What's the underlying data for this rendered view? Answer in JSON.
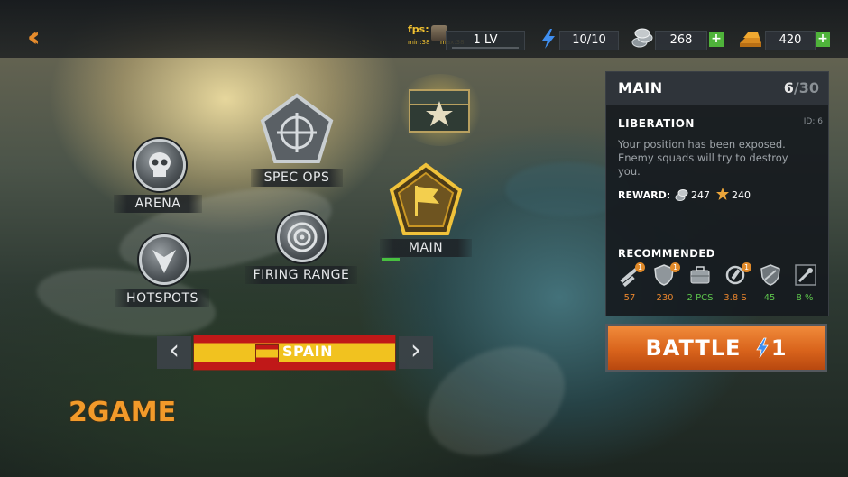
{
  "topbar": {
    "back_icon": "double-chevron-left-icon",
    "fps": "fps: 42",
    "fps_min": "min:38",
    "fps_max": "max:38",
    "level": "1 LV",
    "energy": "10/10",
    "silver": "268",
    "gold": "420"
  },
  "map": {
    "nodes": [
      {
        "label": "SPEC OPS",
        "icon": "crosshair-pentagon-icon"
      },
      {
        "label": "ARENA",
        "icon": "skull-icon"
      },
      {
        "label": "MAIN",
        "icon": "flag-icon"
      },
      {
        "label": "FIRING RANGE",
        "icon": "target-icon"
      },
      {
        "label": "HOTSPOTS",
        "icon": "chevron-down-icon"
      }
    ]
  },
  "panel": {
    "title": "MAIN",
    "progress_current": "6",
    "progress_total": "/30",
    "mission_name": "LIBERATION",
    "mission_id": "ID: 6",
    "description": "Your position has been exposed. Enemy squads will try to destroy you.",
    "reward_label": "REWARD:",
    "reward_silver": "247",
    "reward_star": "240",
    "recommended_label": "RECOMMENDED",
    "recommended": [
      {
        "icon": "bullets-icon",
        "value": "57",
        "badge": "1",
        "color": "#e8852e"
      },
      {
        "icon": "shield-icon",
        "value": "230",
        "badge": "1",
        "color": "#e8852e"
      },
      {
        "icon": "case-icon",
        "value": "2 PCS",
        "badge": "",
        "color": "#5dc44c"
      },
      {
        "icon": "reload-icon",
        "value": "3.8 S",
        "badge": "1",
        "color": "#e8852e"
      },
      {
        "icon": "armor-shield-icon",
        "value": "45",
        "badge": "",
        "color": "#5dc44c"
      },
      {
        "icon": "grenade-icon",
        "value": "8 %",
        "badge": "",
        "color": "#5dc44c"
      }
    ]
  },
  "battle": {
    "label": "BATTLE",
    "cost": "1"
  },
  "country": {
    "name": "SPAIN"
  },
  "watermark": "2GAME"
}
